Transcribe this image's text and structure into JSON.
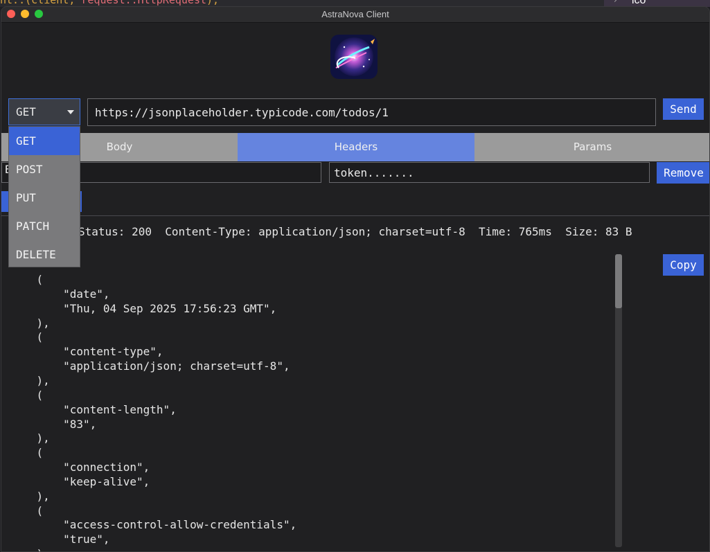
{
  "background": {
    "code_a": "nt::",
    "code_b": "request::HttpRequest",
    "sidebar_text": "ico"
  },
  "window": {
    "title": "AstraNova Client"
  },
  "request": {
    "method": "GET",
    "url": "https://jsonplaceholder.typicode.com/todos/1",
    "send_label": "Send"
  },
  "method_options": [
    "GET",
    "POST",
    "PUT",
    "PATCH",
    "DELETE"
  ],
  "tabs": [
    {
      "label": "Body"
    },
    {
      "label": "Headers",
      "active": true
    },
    {
      "label": "Params"
    }
  ],
  "header_row": {
    "key_partial": "B",
    "value": "token.......",
    "remove_label": "Remove"
  },
  "response_meta": {
    "status_line": "Status: 200  Content-Type: application/json; charset=utf-8  Time: 765ms  Size: 83 B"
  },
  "copy_label": "Copy",
  "response_lines": [
    "    (",
    "        \"date\",",
    "        \"Thu, 04 Sep 2025 17:56:23 GMT\",",
    "    ),",
    "    (",
    "        \"content-type\",",
    "        \"application/json; charset=utf-8\",",
    "    ),",
    "    (",
    "        \"content-length\",",
    "        \"83\",",
    "    ),",
    "    (",
    "        \"connection\",",
    "        \"keep-alive\",",
    "    ),",
    "    (",
    "        \"access-control-allow-credentials\",",
    "        \"true\",",
    "    ),"
  ],
  "colors": {
    "accent": "#3a63d6",
    "active_tab": "#6584df",
    "inactive_tab": "#9b9b9b",
    "window_bg": "#202022"
  }
}
